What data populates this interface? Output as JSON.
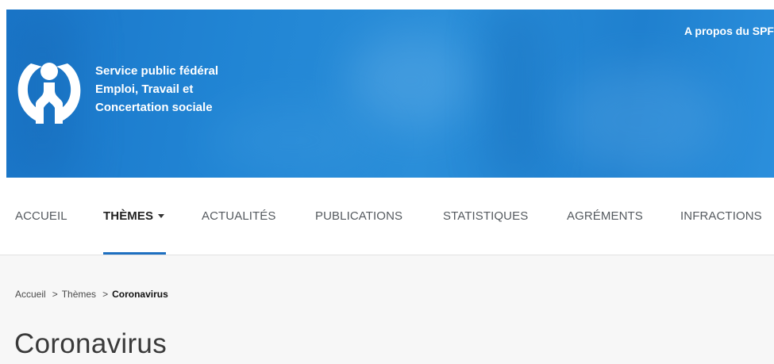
{
  "header": {
    "org_line1": "Service public fédéral",
    "org_line2": "Emploi, Travail et",
    "org_line3": "Concertation sociale",
    "about_link": "A propos du SPF",
    "logo_icon": "spf-emploi-logo-icon",
    "banner_color": "#1f80cf"
  },
  "nav": {
    "items": [
      {
        "label": "ACCUEIL"
      },
      {
        "label": "THÈMES"
      },
      {
        "label": "ACTUALITÉS"
      },
      {
        "label": "PUBLICATIONS"
      },
      {
        "label": "STATISTIQUES"
      },
      {
        "label": "AGRÉMENTS"
      },
      {
        "label": "INFRACTIONS"
      }
    ],
    "active_label": "THÈMES",
    "accent_color": "#1d6fc0"
  },
  "breadcrumb": {
    "home": "Accueil",
    "section": "Thèmes",
    "current": "Coronavirus",
    "separator": ">"
  },
  "page": {
    "title": "Coronavirus"
  }
}
